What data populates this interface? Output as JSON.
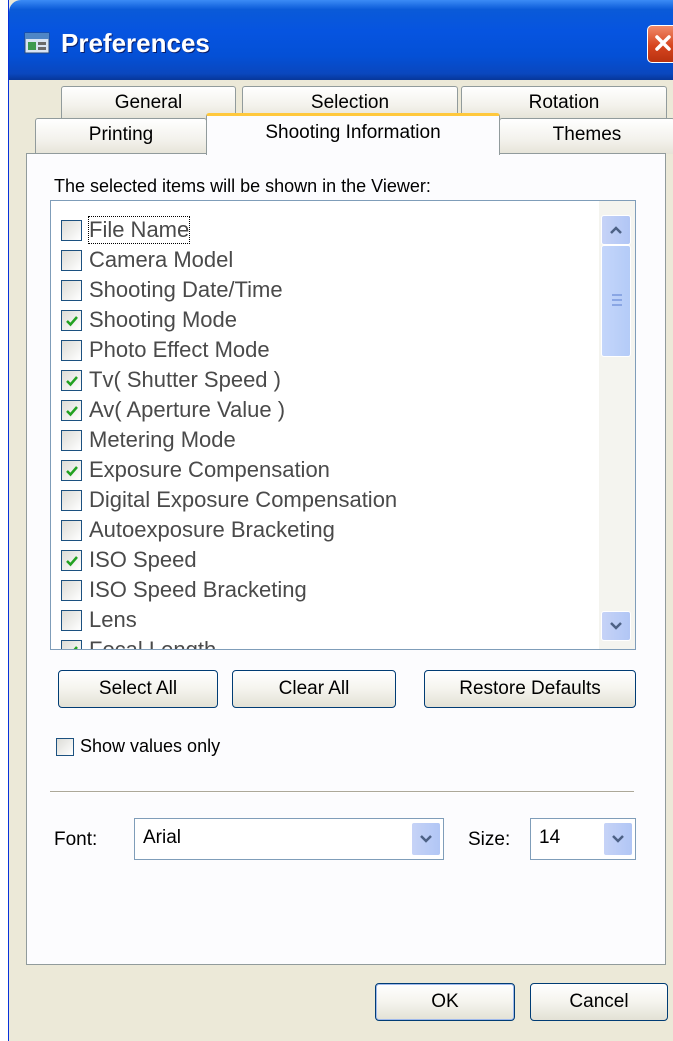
{
  "window": {
    "title": "Preferences"
  },
  "tabs": {
    "row_back": [
      "General",
      "Selection",
      "Rotation"
    ],
    "row_front": [
      "Printing",
      "Shooting Information",
      "Themes"
    ],
    "active": "Shooting Information"
  },
  "page": {
    "caption": "The selected items will be shown in the Viewer:",
    "items": [
      {
        "label": "File Name",
        "checked": false
      },
      {
        "label": "Camera Model",
        "checked": false
      },
      {
        "label": "Shooting Date/Time",
        "checked": false
      },
      {
        "label": "Shooting Mode",
        "checked": true
      },
      {
        "label": "Photo Effect Mode",
        "checked": false
      },
      {
        "label": "Tv( Shutter Speed )",
        "checked": true
      },
      {
        "label": "Av( Aperture Value )",
        "checked": true
      },
      {
        "label": "Metering Mode",
        "checked": false
      },
      {
        "label": "Exposure Compensation",
        "checked": true
      },
      {
        "label": "Digital Exposure Compensation",
        "checked": false
      },
      {
        "label": "Autoexposure Bracketing",
        "checked": false
      },
      {
        "label": "ISO Speed",
        "checked": true
      },
      {
        "label": "ISO Speed Bracketing",
        "checked": false
      },
      {
        "label": "Lens",
        "checked": false
      },
      {
        "label": "Focal Length",
        "checked": true
      }
    ],
    "select_all": "Select All",
    "clear_all": "Clear All",
    "restore_defaults": "Restore Defaults",
    "show_values_only": "Show values only",
    "font_label": "Font:",
    "font_value": "Arial",
    "size_label": "Size:",
    "size_value": "14"
  },
  "footer": {
    "ok": "OK",
    "cancel": "Cancel"
  },
  "colors": {
    "titlebar": "#0654e0",
    "active_tab_accent": "#ffc83c",
    "dialog_bg": "#ece9d8"
  }
}
